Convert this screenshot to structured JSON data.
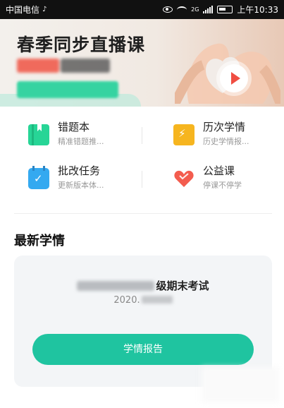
{
  "status_bar": {
    "carrier": "中国电信",
    "network": "2G",
    "time": "上午10:33",
    "icons": [
      "tiktok-icon",
      "eye-icon",
      "wifi-icon",
      "signal-icon",
      "battery-icon"
    ]
  },
  "banner": {
    "title": "春季同步直播课",
    "play_icon": "play-icon"
  },
  "features": [
    {
      "title": "错题本",
      "subtitle": "精准错题推...",
      "icon": "book-icon",
      "color": "#27d596"
    },
    {
      "title": "历次学情",
      "subtitle": "历史学情报...",
      "icon": "trend-icon",
      "color": "#f6b51f"
    },
    {
      "title": "批改任务",
      "subtitle": "更新版本体...",
      "icon": "calendar-check-icon",
      "color": "#34a9f0"
    },
    {
      "title": "公益课",
      "subtitle": "停课不停学",
      "icon": "heart-icon",
      "color": "#f35c4e"
    }
  ],
  "latest": {
    "section_title": "最新学情",
    "exam_suffix": "级期末考试",
    "date_prefix": "2020.",
    "button_label": "学情报告"
  },
  "colors": {
    "accent": "#1fc4a0",
    "card_bg": "#f3f5f7"
  }
}
